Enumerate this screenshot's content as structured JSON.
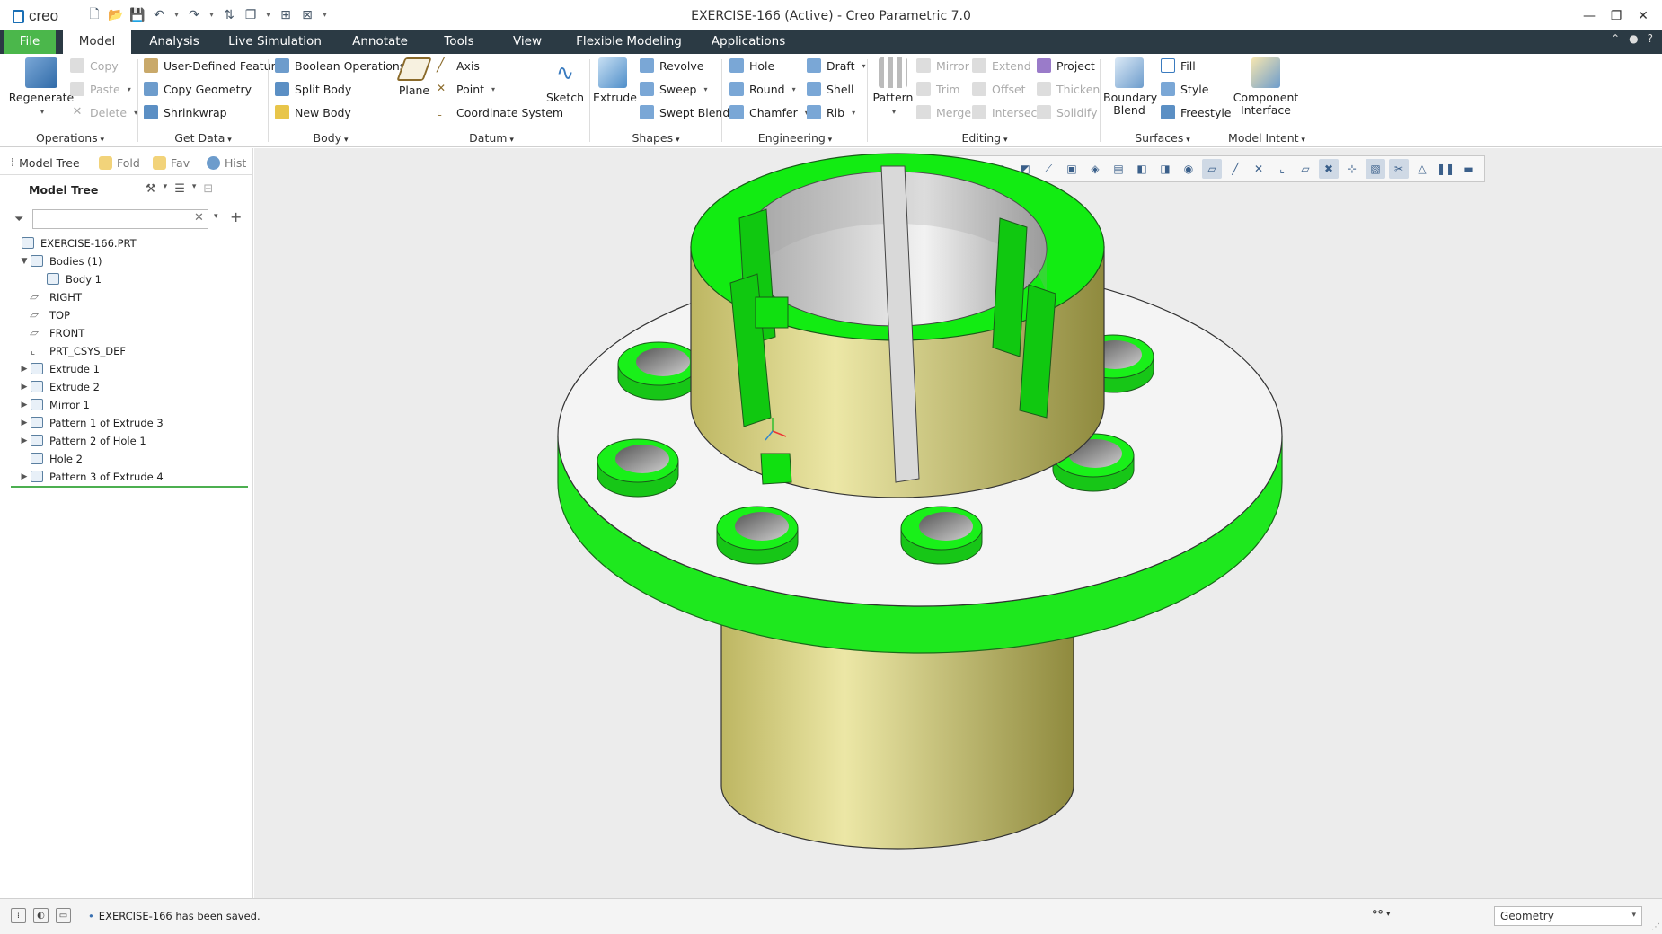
{
  "window": {
    "title": "EXERCISE-166 (Active) - Creo Parametric 7.0",
    "logo": "creo"
  },
  "tabs": [
    "File",
    "Model",
    "Analysis",
    "Live Simulation",
    "Annotate",
    "Tools",
    "View",
    "Flexible Modeling",
    "Applications"
  ],
  "ribbon": {
    "operations": {
      "label": "Operations",
      "regenerate": "Regenerate",
      "copy": "Copy",
      "paste": "Paste",
      "delete": "Delete"
    },
    "getdata": {
      "label": "Get Data",
      "udf": "User-Defined Feature",
      "copy_geometry": "Copy Geometry",
      "shrinkwrap": "Shrinkwrap"
    },
    "body": {
      "label": "Body",
      "boolean": "Boolean Operations",
      "split": "Split Body",
      "new": "New Body"
    },
    "datum": {
      "label": "Datum",
      "plane": "Plane",
      "axis": "Axis",
      "point": "Point",
      "csys": "Coordinate System",
      "sketch": "Sketch"
    },
    "shapes": {
      "label": "Shapes",
      "extrude": "Extrude",
      "revolve": "Revolve",
      "sweep": "Sweep",
      "swept_blend": "Swept Blend"
    },
    "engineering": {
      "label": "Engineering",
      "hole": "Hole",
      "round": "Round",
      "chamfer": "Chamfer",
      "draft": "Draft",
      "shell": "Shell",
      "rib": "Rib"
    },
    "editing": {
      "label": "Editing",
      "pattern": "Pattern",
      "mirror": "Mirror",
      "trim": "Trim",
      "merge": "Merge",
      "extend": "Extend",
      "offset": "Offset",
      "intersect": "Intersect",
      "project": "Project",
      "thicken": "Thicken",
      "solidify": "Solidify"
    },
    "surfaces": {
      "label": "Surfaces",
      "boundary": "Boundary",
      "blend": "Blend",
      "fill": "Fill",
      "style": "Style",
      "freestyle": "Freestyle"
    },
    "modelintent": {
      "label": "Model Intent",
      "component": "Component",
      "interface": "Interface"
    }
  },
  "leftpanel": {
    "tabs": [
      "Model Tree",
      "Fold",
      "Fav",
      "Hist"
    ],
    "title": "Model Tree",
    "search_value": "",
    "tree": [
      {
        "label": "EXERCISE-166.PRT",
        "expander": ""
      },
      {
        "label": "Bodies (1)",
        "expander": "▼"
      },
      {
        "label": "Body 1",
        "expander": ""
      },
      {
        "label": "RIGHT",
        "expander": ""
      },
      {
        "label": "TOP",
        "expander": ""
      },
      {
        "label": "FRONT",
        "expander": ""
      },
      {
        "label": "PRT_CSYS_DEF",
        "expander": ""
      },
      {
        "label": "Extrude 1",
        "expander": "▶"
      },
      {
        "label": "Extrude 2",
        "expander": "▶"
      },
      {
        "label": "Mirror 1",
        "expander": "▶"
      },
      {
        "label": "Pattern 1 of Extrude 3",
        "expander": "▶"
      },
      {
        "label": "Pattern 2 of Hole 1",
        "expander": "▶"
      },
      {
        "label": "Hole 2",
        "expander": ""
      },
      {
        "label": "Pattern 3 of Extrude 4",
        "expander": "▶"
      }
    ]
  },
  "status": {
    "message": "EXERCISE-166 has been saved.",
    "filter": "Geometry"
  },
  "colors": {
    "accent_green": "#4bb74b",
    "model_green": "#00ee00",
    "model_tan": "#d9d38a",
    "ribbon_dark": "#2b3a44"
  }
}
